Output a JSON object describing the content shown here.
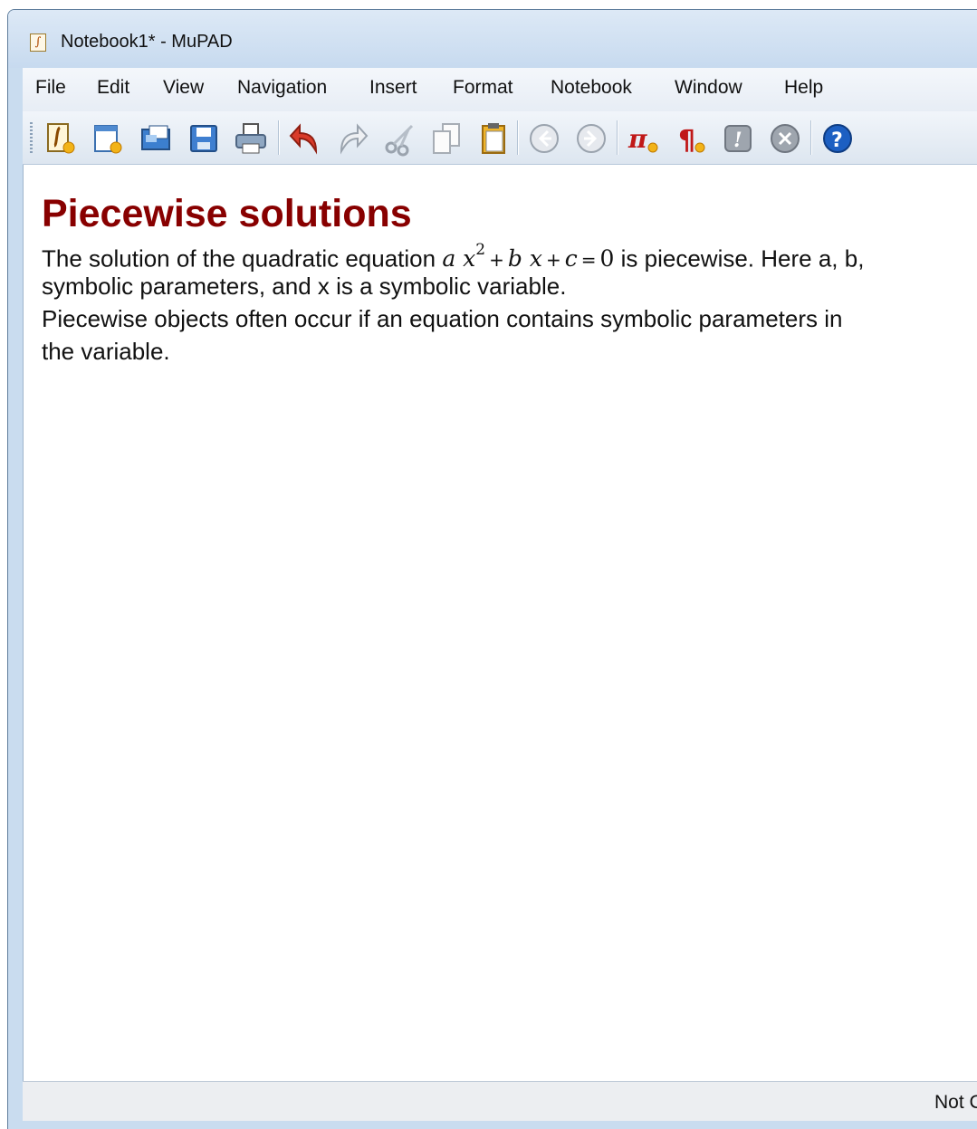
{
  "window": {
    "title": "Notebook1* - MuPAD"
  },
  "menu": {
    "items": [
      "File",
      "Edit",
      "View",
      "Navigation",
      "Insert",
      "Format",
      "Notebook",
      "Window",
      "Help"
    ]
  },
  "toolbar": {
    "icons": [
      "new-notebook-icon",
      "new-editor-icon",
      "open-icon",
      "save-icon",
      "print-icon",
      "undo-icon",
      "redo-icon",
      "cut-icon",
      "copy-icon",
      "paste-icon",
      "back-icon",
      "forward-icon",
      "insert-calculation-icon",
      "insert-text-icon",
      "evaluate-icon",
      "stop-icon",
      "help-icon"
    ]
  },
  "document": {
    "heading": "Piecewise solutions",
    "para1_before": "The solution of the quadratic equation ",
    "eq": {
      "a": "a",
      "x": "x",
      "exp": "2",
      "plus1": "+",
      "b": "b",
      "x2": "x",
      "plus2": "+",
      "c": "c",
      "eq": "=",
      "zero": "0"
    },
    "para1_after": " is piecewise. Here a, b,",
    "para2": "symbolic parameters, and x is a symbolic variable.",
    "para3": "Piecewise objects often occur if an equation contains symbolic parameters in",
    "para4": "the variable."
  },
  "statusbar": {
    "text": "Not C"
  },
  "colors": {
    "heading": "#880000",
    "frame": "#c9dcef"
  }
}
